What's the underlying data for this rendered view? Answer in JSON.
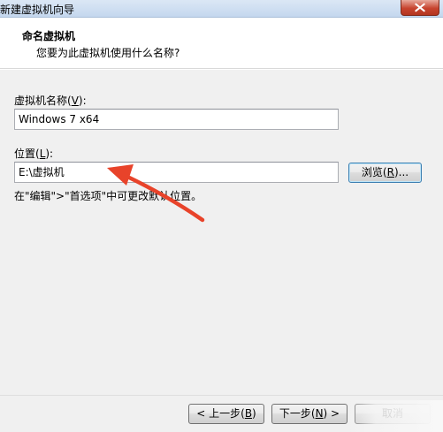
{
  "window": {
    "title": "新建虚拟机向导"
  },
  "header": {
    "title": "命名虚拟机",
    "subtitle": "您要为此虚拟机使用什么名称?"
  },
  "form": {
    "name_label_prefix": "虚拟机名称(",
    "name_label_key": "V",
    "name_label_suffix": "):",
    "name_value": "Windows 7 x64",
    "location_label_prefix": "位置(",
    "location_label_key": "L",
    "location_label_suffix": "):",
    "location_value": "E:\\虚拟机",
    "browse_prefix": "浏览(",
    "browse_key": "R",
    "browse_suffix": ")...",
    "hint": "在\"编辑\">\"首选项\"中可更改默认位置。"
  },
  "footer": {
    "back_prefix": "< 上一步(",
    "back_key": "B",
    "back_suffix": ")",
    "next_prefix": "下一步(",
    "next_key": "N",
    "next_suffix": ") >",
    "cancel_label": "取消"
  },
  "annotation": {
    "arrow_color": "#e8432a"
  }
}
